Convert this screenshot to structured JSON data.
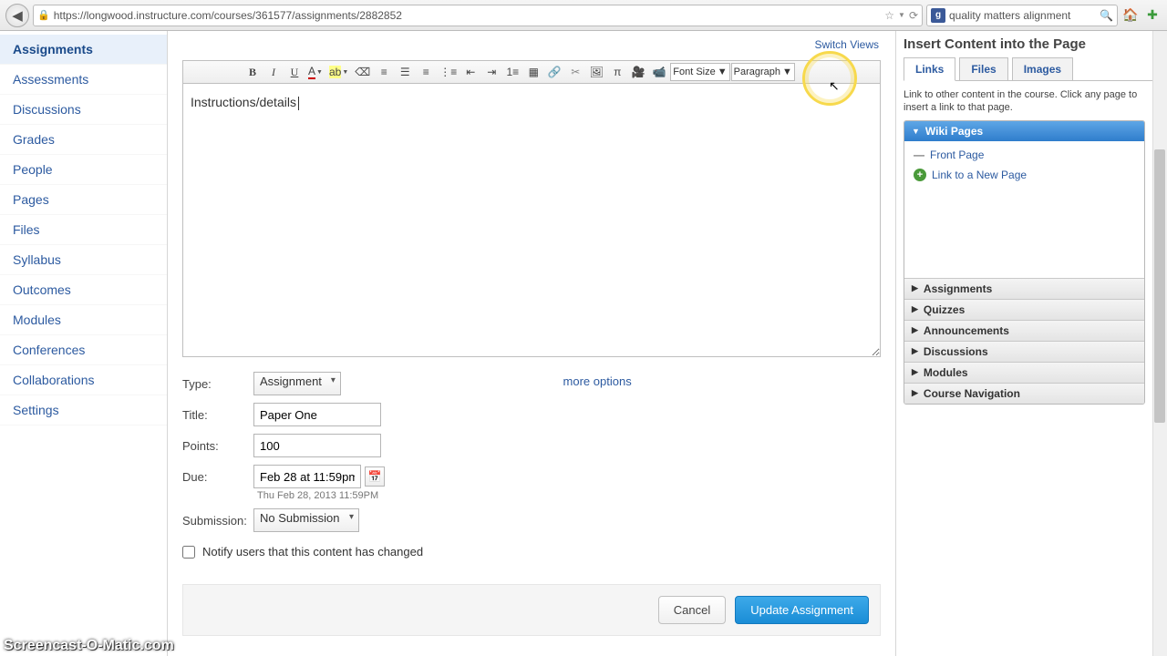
{
  "browser": {
    "url": "https://longwood.instructure.com/courses/361577/assignments/2882852",
    "search_value": "quality matters alignment"
  },
  "sidebar": {
    "items": [
      {
        "label": "Assignments",
        "active": true
      },
      {
        "label": "Assessments"
      },
      {
        "label": "Discussions"
      },
      {
        "label": "Grades"
      },
      {
        "label": "People"
      },
      {
        "label": "Pages"
      },
      {
        "label": "Files"
      },
      {
        "label": "Syllabus"
      },
      {
        "label": "Outcomes"
      },
      {
        "label": "Modules"
      },
      {
        "label": "Conferences"
      },
      {
        "label": "Collaborations"
      },
      {
        "label": "Settings"
      }
    ]
  },
  "main": {
    "switch_views": "Switch Views",
    "editor_text": "Instructions/details",
    "font_size_label": "Font Size",
    "paragraph_label": "Paragraph",
    "more_options": "more options"
  },
  "form": {
    "type_label": "Type:",
    "type_value": "Assignment",
    "title_label": "Title:",
    "title_value": "Paper One",
    "points_label": "Points:",
    "points_value": "100",
    "due_label": "Due:",
    "due_value": "Feb 28 at 11:59pm",
    "due_hint": "Thu Feb 28, 2013 11:59PM",
    "submission_label": "Submission:",
    "submission_value": "No Submission",
    "notify_label": "Notify users that this content has changed",
    "cancel": "Cancel",
    "update": "Update Assignment"
  },
  "right": {
    "title": "Insert Content into the Page",
    "tabs": {
      "links": "Links",
      "files": "Files",
      "images": "Images"
    },
    "desc": "Link to other content in the course. Click any page to insert a link to that page.",
    "wiki_head": "Wiki Pages",
    "front_page": "Front Page",
    "new_page": "Link to a New Page",
    "sections": [
      "Assignments",
      "Quizzes",
      "Announcements",
      "Discussions",
      "Modules",
      "Course Navigation"
    ]
  },
  "watermark": "Screencast-O-Matic.com"
}
